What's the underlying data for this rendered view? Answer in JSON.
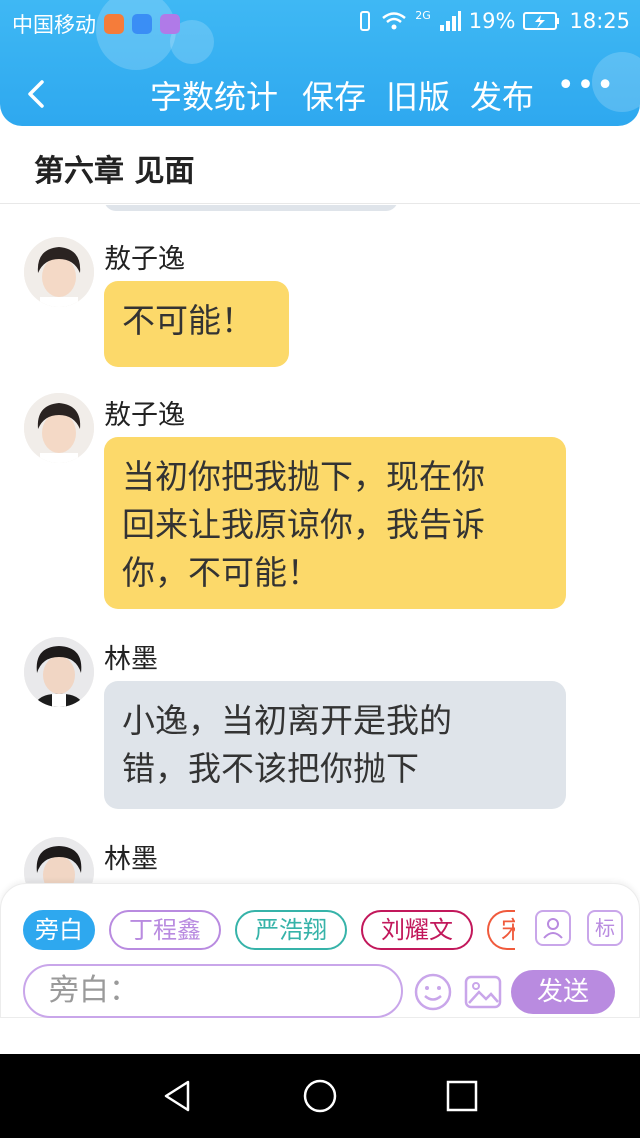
{
  "status_bar": {
    "carrier": "中国移动",
    "network": "2G",
    "battery": "19%",
    "time": "18:25"
  },
  "toolbar": {
    "word_count": "字数统计",
    "save": "保存",
    "old_version": "旧版",
    "publish": "发布",
    "more": "•••"
  },
  "chapter_title": "第六章 见面",
  "messages": [
    {
      "sender": "敖子逸",
      "text": "不可能！",
      "style": "yellow"
    },
    {
      "sender": "敖子逸",
      "lines": [
        "当初你把我抛下，现在你",
        "回来让我原谅你，我告诉",
        "你，不可能！"
      ],
      "style": "yellow"
    },
    {
      "sender": "林墨",
      "lines": [
        "小逸，当初离开是我的",
        "错，我不该把你抛下"
      ],
      "style": "gray"
    },
    {
      "sender": "林墨"
    }
  ],
  "characters": [
    {
      "label": "旁白",
      "color": "#2ea8ef"
    },
    {
      "label": "丁程鑫",
      "color": "#b98be0"
    },
    {
      "label": "严浩翔",
      "color": "#36b3a9"
    },
    {
      "label": "刘耀文",
      "color": "#c2185b"
    },
    {
      "label": "宋",
      "color": "#f05a3c"
    }
  ],
  "tag_icon_label": "标",
  "input": {
    "placeholder": "旁白："
  },
  "send_label": "发送"
}
